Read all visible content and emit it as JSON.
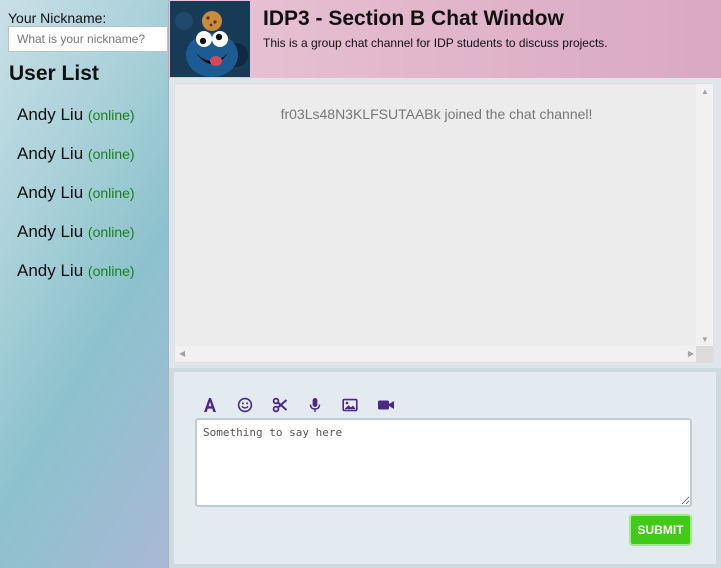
{
  "sidebar": {
    "nickname_label": "Your Nickname:",
    "nickname_placeholder": "What is your nickname?",
    "user_list_title": "User List",
    "users": [
      {
        "name": "Andy Liu",
        "status": "(online)"
      },
      {
        "name": "Andy Liu",
        "status": "(online)"
      },
      {
        "name": "Andy Liu",
        "status": "(online)"
      },
      {
        "name": "Andy Liu",
        "status": "(online)"
      },
      {
        "name": "Andy Liu",
        "status": "(online)"
      }
    ]
  },
  "header": {
    "title": "IDP3 - Section B Chat Window",
    "subtitle": "This is a group chat channel for IDP students to discuss projects.",
    "avatar_icon": "cookie-monster-icon"
  },
  "messages": [
    {
      "text": "fr03Ls48N3KLFSUTAABk joined the chat channel!"
    }
  ],
  "composer": {
    "tools": [
      {
        "name": "font-icon"
      },
      {
        "name": "emoji-icon"
      },
      {
        "name": "scissors-icon"
      },
      {
        "name": "microphone-icon"
      },
      {
        "name": "image-icon"
      },
      {
        "name": "video-icon"
      }
    ],
    "message_placeholder": "Something to say here",
    "submit_label": "SUBMIT"
  },
  "colors": {
    "online": "#1a7f1a",
    "toolbar_icon": "#4b2886",
    "submit": "#43c917"
  }
}
